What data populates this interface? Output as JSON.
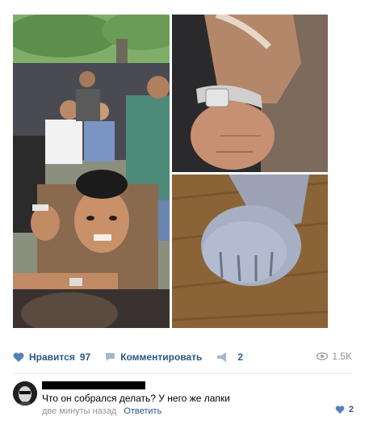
{
  "post": {
    "images": [
      {
        "name": "crowd-photo",
        "alt": ""
      },
      {
        "name": "wrist-watch-photo",
        "alt": ""
      },
      {
        "name": "cat-paw-photo",
        "alt": ""
      }
    ]
  },
  "actions": {
    "like_label": "Нравится",
    "like_count": "97",
    "comment_label": "Комментировать",
    "share_count": "2",
    "views": "1.5K"
  },
  "comment": {
    "text": "Что он собрался делать? У него же лапки",
    "time": "две минуты назад",
    "reply_label": "Ответить",
    "likes": "2"
  },
  "colors": {
    "link": "#2a5885",
    "muted": "#939393",
    "divider": "#e7e8ec"
  },
  "icons": [
    "heart-icon",
    "comment-icon",
    "share-icon",
    "eye-icon"
  ]
}
